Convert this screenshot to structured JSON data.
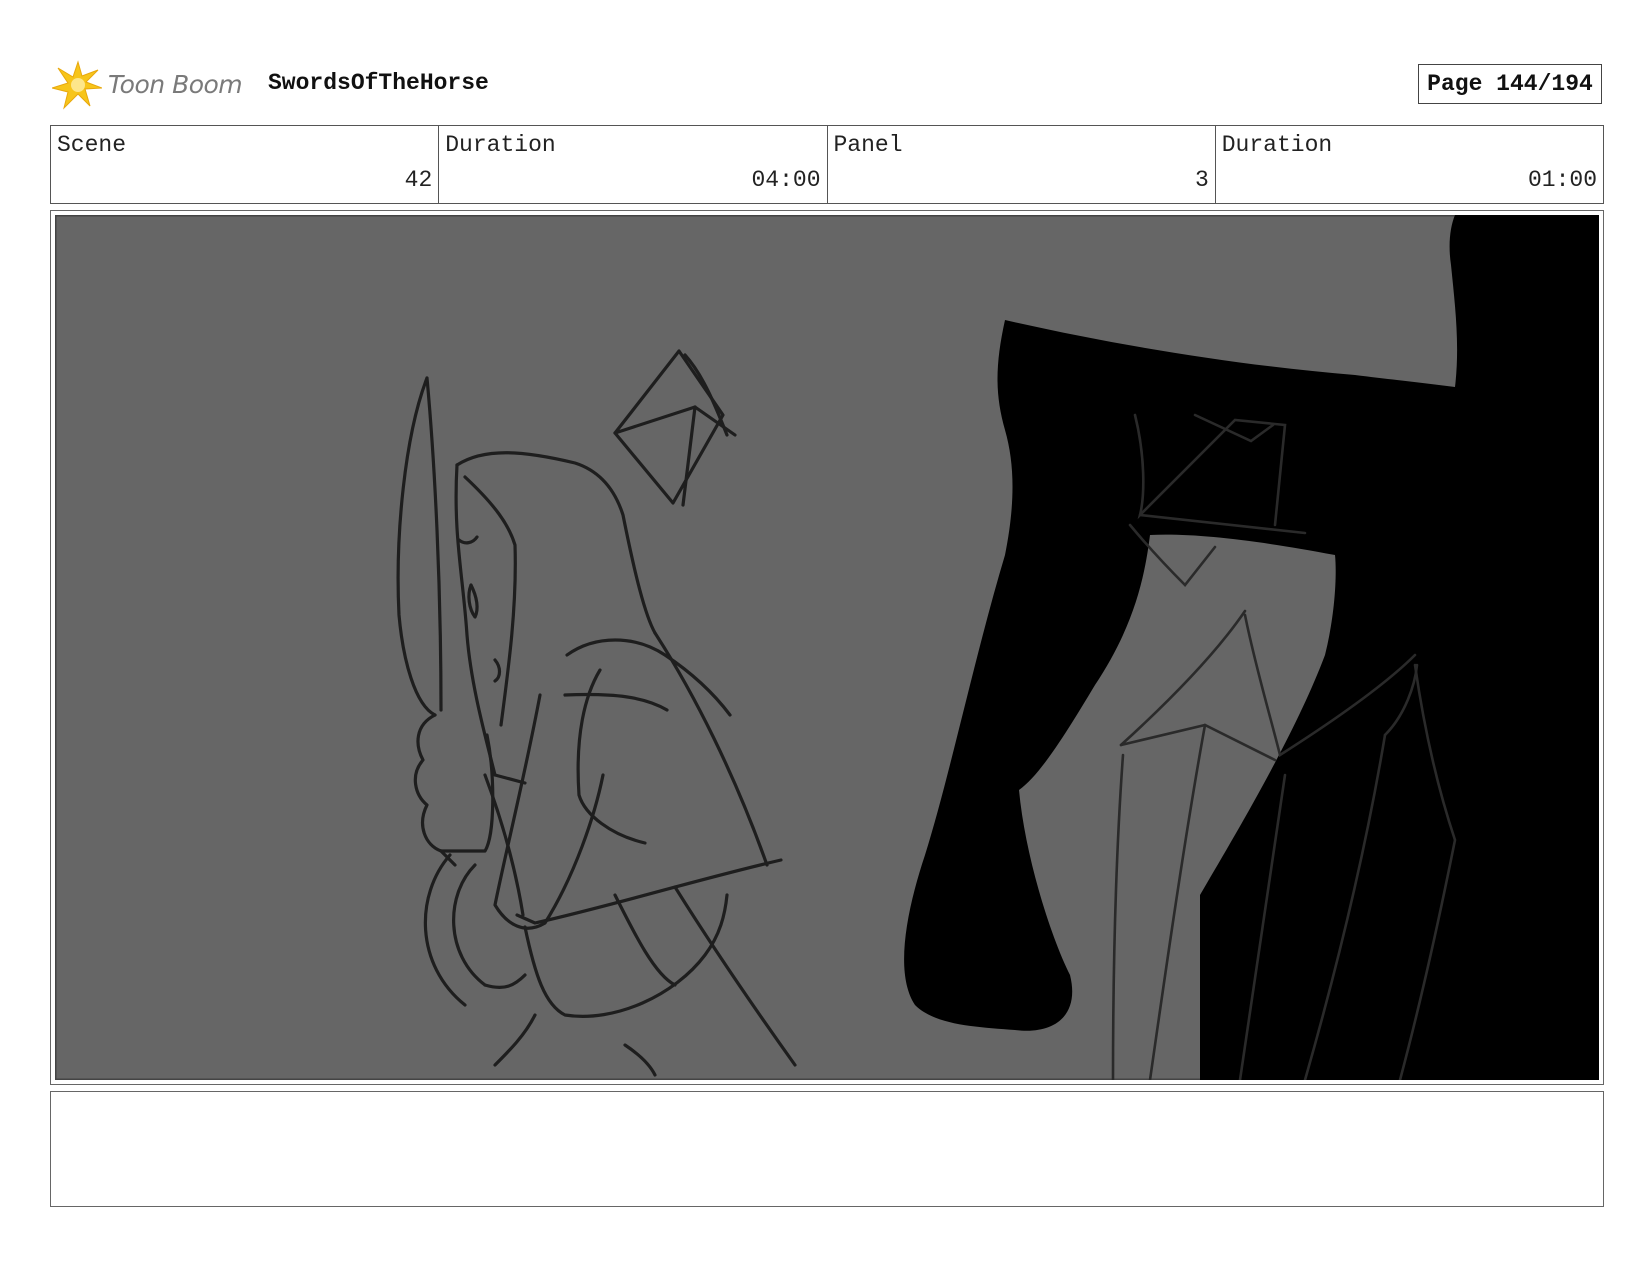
{
  "header": {
    "logo_text": "Toon Boom",
    "project_title": "SwordsOfTheHorse",
    "page_label": "Page 144/194"
  },
  "info": {
    "scene_label": "Scene",
    "scene_value": "42",
    "scene_duration_label": "Duration",
    "scene_duration_value": "04:00",
    "panel_label": "Panel",
    "panel_value": "3",
    "panel_duration_label": "Duration",
    "panel_duration_value": "01:00"
  },
  "panel": {
    "background_color": "#666666",
    "line_color": "#1e1e1e",
    "silhouette_color": "#000000"
  },
  "caption": {
    "text": ""
  }
}
